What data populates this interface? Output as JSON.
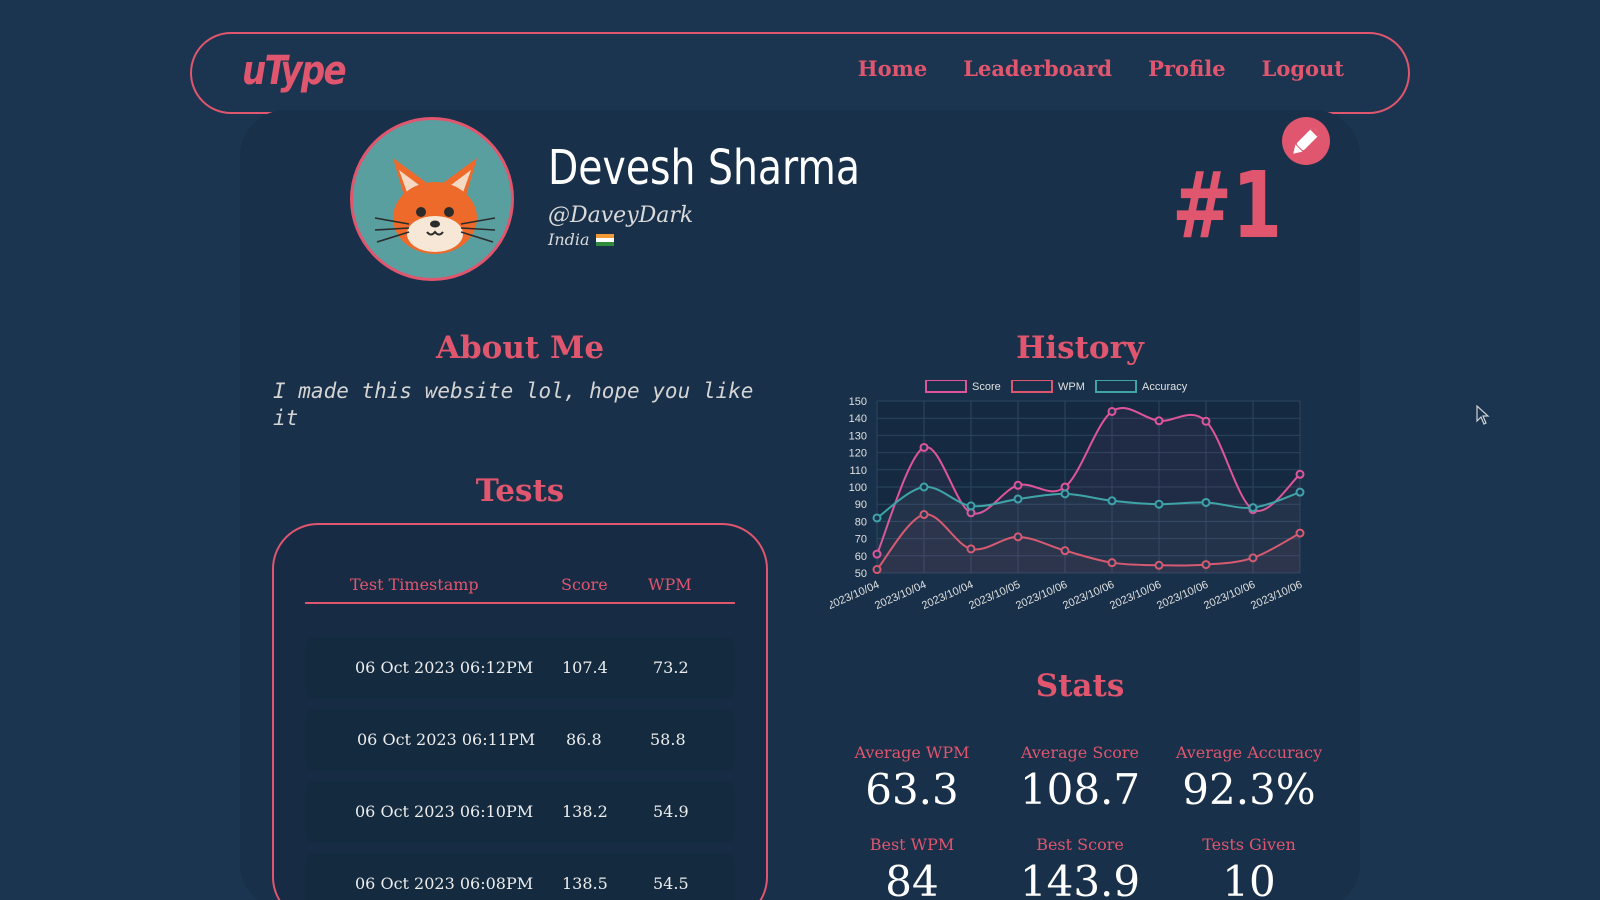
{
  "nav": {
    "logo": "uType",
    "links": [
      "Home",
      "Leaderboard",
      "Profile",
      "Logout"
    ]
  },
  "profile": {
    "name": "Devesh Sharma",
    "handle": "@DaveyDark",
    "country": "India",
    "rank": "#1",
    "avatar_icon": "fox-avatar",
    "edit_icon": "pencil-icon"
  },
  "about": {
    "title": "About Me",
    "text": "I made this website lol, hope you like it"
  },
  "tests": {
    "title": "Tests",
    "headers": [
      "Test Timestamp",
      "Score",
      "WPM"
    ],
    "rows": [
      {
        "timestamp": "06 Oct 2023 06:12PM",
        "score": "107.4",
        "wpm": "73.2"
      },
      {
        "timestamp": "06 Oct 2023 06:11PM",
        "score": "86.8",
        "wpm": "58.8"
      },
      {
        "timestamp": "06 Oct 2023 06:10PM",
        "score": "138.2",
        "wpm": "54.9"
      },
      {
        "timestamp": "06 Oct 2023 06:08PM",
        "score": "138.5",
        "wpm": "54.5"
      }
    ]
  },
  "history": {
    "title": "History"
  },
  "chart_data": {
    "type": "line",
    "x": [
      "2023/10/04",
      "2023/10/04",
      "2023/10/04",
      "2023/10/05",
      "2023/10/06",
      "2023/10/06",
      "2023/10/06",
      "2023/10/06",
      "2023/10/06",
      "2023/10/06"
    ],
    "series": [
      {
        "name": "Score",
        "color": "#e0559a",
        "values": [
          61,
          123,
          85,
          101,
          100,
          143.9,
          138.5,
          138.2,
          86.8,
          107.4
        ]
      },
      {
        "name": "WPM",
        "color": "#e0566e",
        "values": [
          52,
          84,
          64,
          71,
          63,
          56,
          54.5,
          54.9,
          58.8,
          73.2
        ]
      },
      {
        "name": "Accuracy",
        "color": "#3fa3a8",
        "values": [
          82,
          100,
          89,
          93,
          96,
          92,
          90,
          91,
          88,
          97
        ]
      }
    ],
    "ylim": [
      50,
      150
    ],
    "yticks": [
      50,
      60,
      70,
      80,
      90,
      100,
      110,
      120,
      130,
      140,
      150
    ],
    "legend": "top",
    "grid": true
  },
  "stats": {
    "title": "Stats",
    "items": [
      {
        "label": "Average WPM",
        "value": "63.3"
      },
      {
        "label": "Average Score",
        "value": "108.7"
      },
      {
        "label": "Average Accuracy",
        "value": "92.3%"
      },
      {
        "label": "Best WPM",
        "value": "84"
      },
      {
        "label": "Best Score",
        "value": "143.9"
      },
      {
        "label": "Tests Given",
        "value": "10"
      }
    ]
  }
}
